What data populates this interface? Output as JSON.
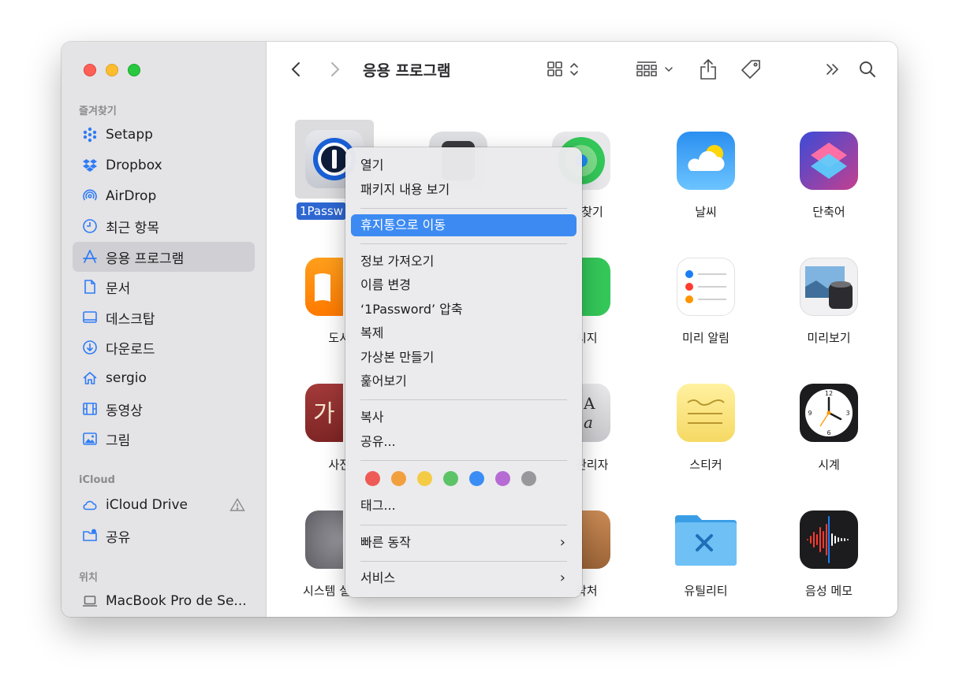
{
  "sidebar": {
    "favorites_header": "즐겨찾기",
    "favorites": [
      {
        "label": "Setapp",
        "icon": "setapp-icon"
      },
      {
        "label": "Dropbox",
        "icon": "dropbox-icon"
      },
      {
        "label": "AirDrop",
        "icon": "airdrop-icon"
      },
      {
        "label": "최근 항목",
        "icon": "clock-icon"
      },
      {
        "label": "응용 프로그램",
        "icon": "applications-icon"
      },
      {
        "label": "문서",
        "icon": "document-icon"
      },
      {
        "label": "데스크탑",
        "icon": "desktop-icon"
      },
      {
        "label": "다운로드",
        "icon": "download-icon"
      },
      {
        "label": "sergio",
        "icon": "home-icon"
      },
      {
        "label": "동영상",
        "icon": "film-icon"
      },
      {
        "label": "그림",
        "icon": "photo-icon"
      }
    ],
    "icloud_header": "iCloud",
    "icloud": [
      {
        "label": "iCloud Drive",
        "icon": "cloud-icon"
      },
      {
        "label": "공유",
        "icon": "shared-folder-icon"
      }
    ],
    "locations_header": "위치",
    "locations": [
      {
        "label": "MacBook Pro de Se...",
        "icon": "laptop-icon"
      }
    ]
  },
  "toolbar": {
    "title": "응용 프로그램"
  },
  "files": {
    "selected_label": "1Passw",
    "labels": [
      "찾기",
      "날씨",
      "단축어",
      "도서",
      "시지",
      "미리 알림",
      "미리보기",
      "사전",
      "관리자",
      "스티커",
      "시계",
      "시스템 설",
      "락처",
      "유틸리티",
      "음성 메모"
    ]
  },
  "context_menu": {
    "items": [
      "열기",
      "패키지 내용 보기",
      "휴지통으로 이동",
      "정보 가져오기",
      "이름 변경",
      "‘1Password’ 압축",
      "복제",
      "가상본 만들기",
      "훑어보기",
      "복사",
      "공유...",
      "태그...",
      "빠른 동작",
      "서비스"
    ],
    "tag_colors": [
      "#ee5b57",
      "#f29f3d",
      "#f4cb45",
      "#5cc466",
      "#3a8df5",
      "#b56bd3",
      "#98989c"
    ],
    "submenu_arrow": "›"
  },
  "colors": {
    "accent": "#3d8bf2",
    "selection": "#2e67d2"
  }
}
